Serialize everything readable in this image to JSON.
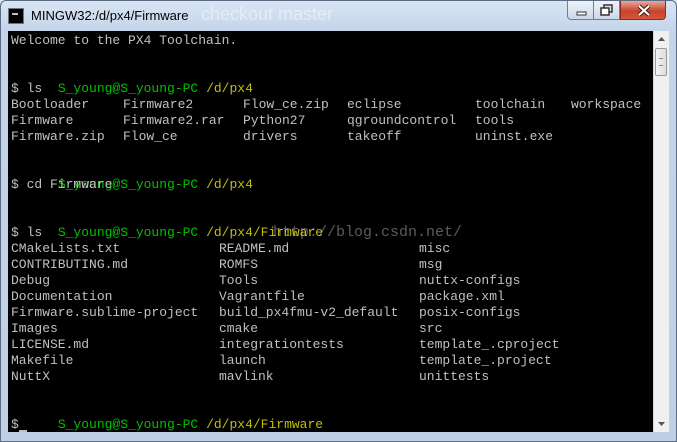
{
  "window": {
    "title": "MINGW32:/d/px4/Firmware",
    "watermark": "checkout master"
  },
  "colors": {
    "prompt_user": "#00c000",
    "prompt_path": "#c0c000",
    "text": "#c0c0c0",
    "background": "#000000"
  },
  "console": {
    "welcome": "Welcome to the PX4 Toolchain.",
    "prompt1": {
      "user": "S_young@S_young-PC",
      "path": "/d/px4"
    },
    "cmd1": "$ ls",
    "ls1_rows": [
      [
        "Bootloader",
        "Firmware2",
        "Flow_ce.zip",
        "eclipse",
        "toolchain",
        "workspace"
      ],
      [
        "Firmware",
        "Firmware2.rar",
        "Python27",
        "qgroundcontrol",
        "tools",
        ""
      ],
      [
        "Firmware.zip",
        "Flow_ce",
        "drivers",
        "takeoff",
        "uninst.exe",
        ""
      ]
    ],
    "prompt2": {
      "user": "S_young@S_young-PC",
      "path": "/d/px4"
    },
    "cmd2": "$ cd Firmware",
    "prompt3": {
      "user": "S_young@S_young-PC",
      "path": "/d/px4/Firmware"
    },
    "cmd3": "$ ls",
    "ls2_rows": [
      [
        "CMakeLists.txt",
        "README.md",
        "misc"
      ],
      [
        "CONTRIBUTING.md",
        "ROMFS",
        "msg"
      ],
      [
        "Debug",
        "Tools",
        "nuttx-configs"
      ],
      [
        "Documentation",
        "Vagrantfile",
        "package.xml"
      ],
      [
        "Firmware.sublime-project",
        "build_px4fmu-v2_default",
        "posix-configs"
      ],
      [
        "Images",
        "cmake",
        "src"
      ],
      [
        "LICENSE.md",
        "integrationtests",
        "template_.cproject"
      ],
      [
        "Makefile",
        "launch",
        "template_.project"
      ],
      [
        "NuttX",
        "mavlink",
        "unittests"
      ]
    ],
    "prompt4": {
      "user": "S_young@S_young-PC",
      "path": "/d/px4/Firmware"
    },
    "cmd4": "$",
    "blog_watermark": "http://blog.csdn.net/"
  }
}
